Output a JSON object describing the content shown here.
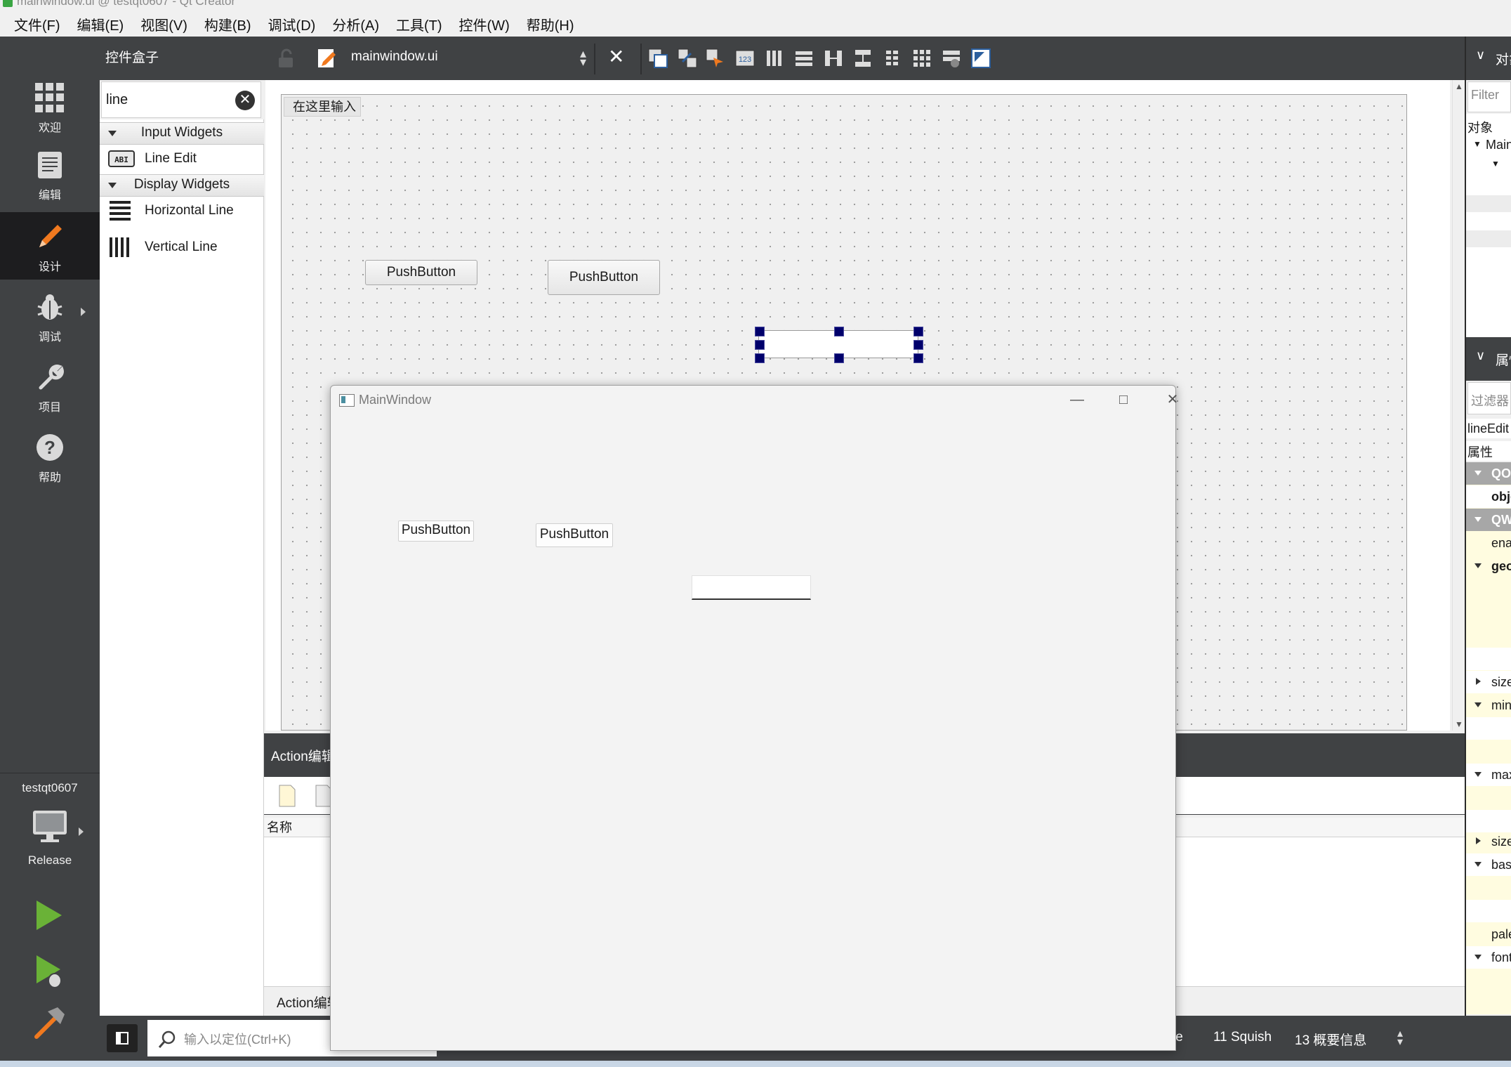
{
  "window": {
    "title": "mainwindow.ui @ testqt0607 - Qt Creator"
  },
  "menubar": [
    "文件(F)",
    "编辑(E)",
    "视图(V)",
    "构建(B)",
    "调试(D)",
    "分析(A)",
    "工具(T)",
    "控件(W)",
    "帮助(H)"
  ],
  "modes": {
    "welcome": "欢迎",
    "edit": "编辑",
    "design": "设计",
    "debug": "调试",
    "projects": "项目",
    "help": "帮助",
    "active": "design"
  },
  "kit": {
    "project": "testqt0607",
    "config": "Release"
  },
  "widget_box": {
    "title": "控件盒子",
    "filter": "line",
    "categories": [
      {
        "name": "Input Widgets",
        "items": [
          {
            "label": "Line Edit",
            "icon": "line-edit-icon"
          }
        ]
      },
      {
        "name": "Display Widgets",
        "items": [
          {
            "label": "Horizontal Line",
            "icon": "horizontal-line-icon"
          },
          {
            "label": "Vertical Line",
            "icon": "vertical-line-icon"
          }
        ]
      }
    ]
  },
  "editor": {
    "file": "mainwindow.ui",
    "menu_placeholder": "在这里输入"
  },
  "form": {
    "buttons": [
      "PushButton",
      "PushButton"
    ]
  },
  "preview": {
    "title": "MainWindow",
    "buttons": [
      "PushButton",
      "PushButton"
    ],
    "controls": [
      "—",
      "□",
      "✕"
    ]
  },
  "action_editor": {
    "title": "Action编辑器",
    "column_name": "名称",
    "tab_label": "Action编辑器"
  },
  "object_inspector": {
    "header": "对象查看器",
    "filter": "Filter",
    "column": "对象",
    "root": "MainWindow"
  },
  "property_editor": {
    "header": "属性编辑器",
    "filter": "过滤器",
    "object": "lineEdit : QLineEdit",
    "column": "属性",
    "rows": [
      {
        "text": "QObject",
        "kind": "group"
      },
      {
        "text": "objectName",
        "kind": "bold"
      },
      {
        "text": "QWidget",
        "kind": "group"
      },
      {
        "text": "enabled",
        "kind": "plain"
      },
      {
        "text": "geometry",
        "kind": "bold-expand"
      },
      {
        "text": "",
        "kind": "plain"
      },
      {
        "text": "",
        "kind": "plain"
      },
      {
        "text": "",
        "kind": "plain"
      },
      {
        "text": "",
        "kind": "plain"
      },
      {
        "text": "sizePolicy",
        "kind": "collapsed"
      },
      {
        "text": "minimumSize",
        "kind": "expand"
      },
      {
        "text": "",
        "kind": "plain"
      },
      {
        "text": "maximumSize",
        "kind": "expand"
      },
      {
        "text": "",
        "kind": "plain"
      },
      {
        "text": "",
        "kind": "plain"
      },
      {
        "text": "sizeIncrement",
        "kind": "collapsed"
      },
      {
        "text": "baseSize",
        "kind": "expand"
      },
      {
        "text": "",
        "kind": "plain"
      },
      {
        "text": "",
        "kind": "plain"
      },
      {
        "text": "palette",
        "kind": "plain"
      },
      {
        "text": "font",
        "kind": "expand"
      }
    ]
  },
  "statusbar": {
    "search_placeholder": "输入以定位(Ctrl+K)",
    "panes": [
      "le",
      "11  Squish",
      "13  概要信息"
    ]
  }
}
